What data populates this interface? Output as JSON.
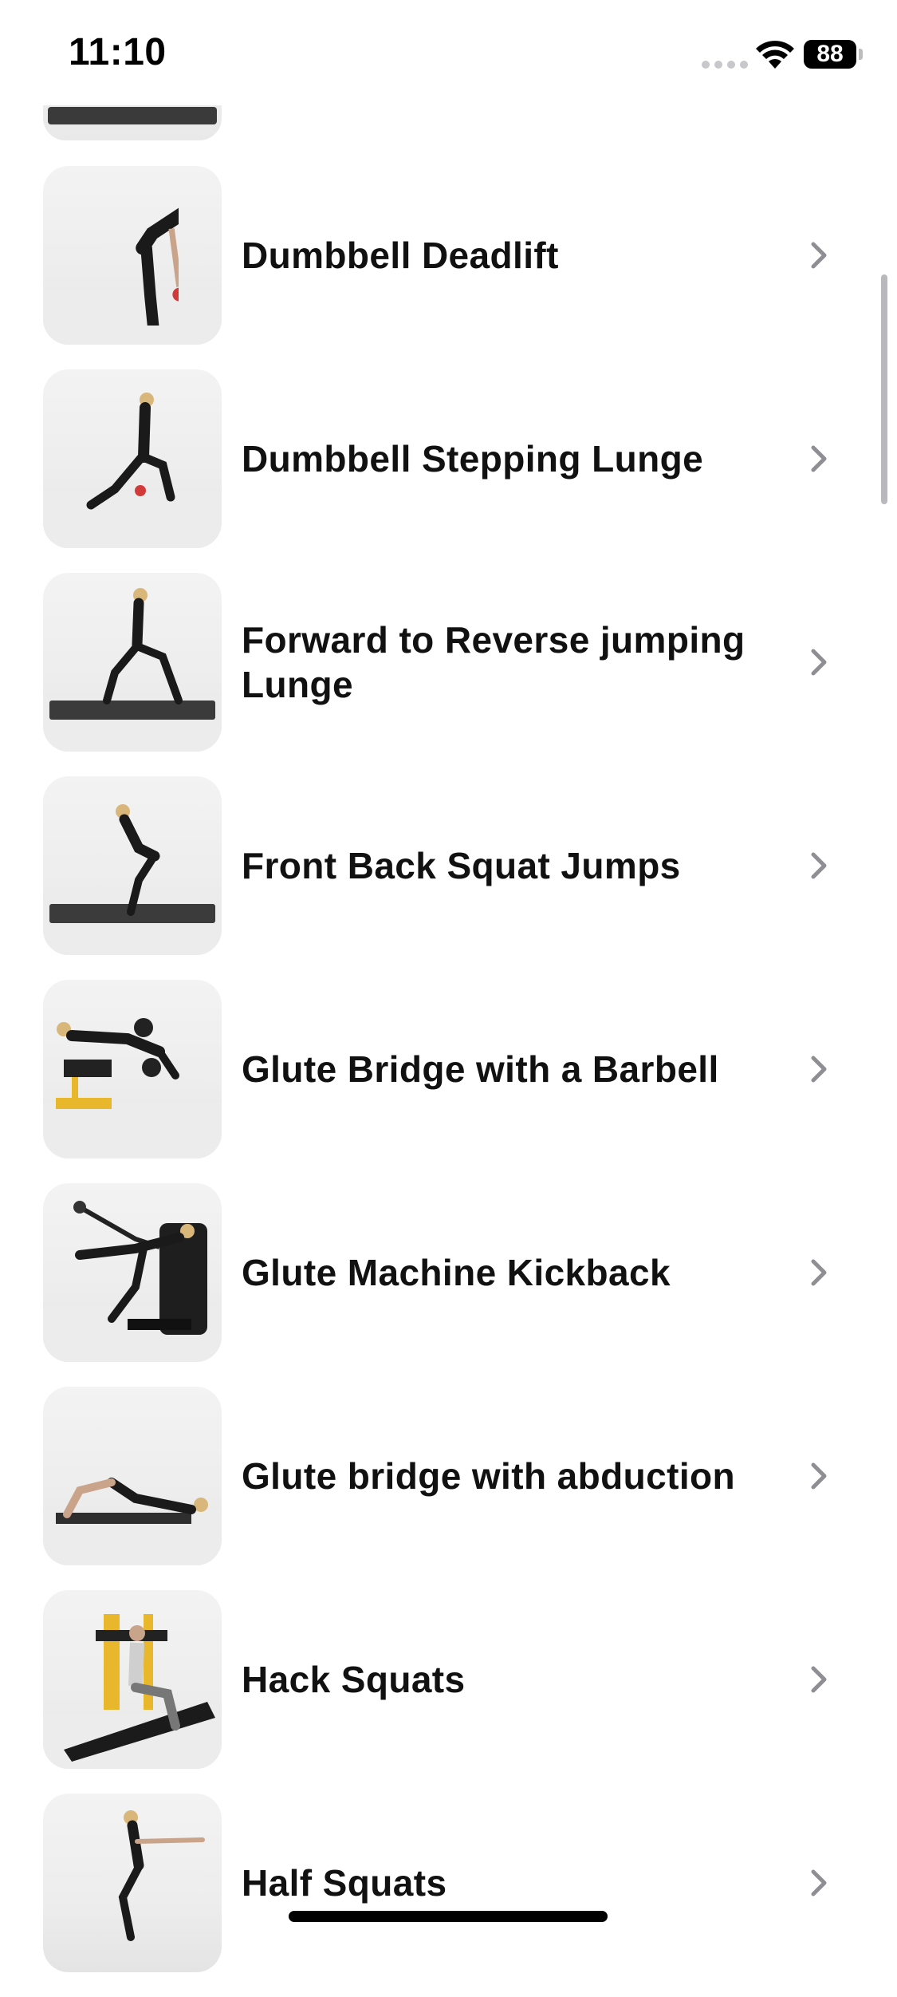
{
  "status_bar": {
    "time": "11:10",
    "battery": "88"
  },
  "exercises": [
    {
      "name": "Dumbbell Deadlift",
      "icon": "chevron-right-icon"
    },
    {
      "name": "Dumbbell Stepping Lunge",
      "icon": "chevron-right-icon"
    },
    {
      "name": "Forward to Reverse jumping Lunge",
      "icon": "chevron-right-icon"
    },
    {
      "name": "Front Back Squat Jumps",
      "icon": "chevron-right-icon"
    },
    {
      "name": "Glute Bridge with a Barbell",
      "icon": "chevron-right-icon"
    },
    {
      "name": "Glute Machine Kickback",
      "icon": "chevron-right-icon"
    },
    {
      "name": "Glute bridge with abduction",
      "icon": "chevron-right-icon"
    },
    {
      "name": "Hack Squats",
      "icon": "chevron-right-icon"
    },
    {
      "name": "Half Squats",
      "icon": "chevron-right-icon"
    }
  ],
  "colors": {
    "background": "#ffffff",
    "text": "#111111",
    "chevron": "#8e8e93",
    "scroll_indicator": "#b9b9bd"
  }
}
